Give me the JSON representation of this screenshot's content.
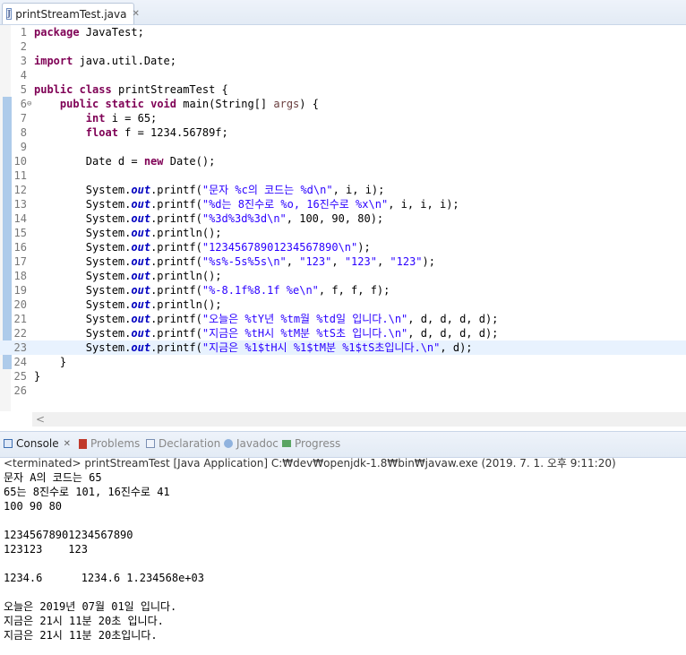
{
  "editor": {
    "tab_label": "printStreamTest.java",
    "tab_close": "✕",
    "file_icon": "J"
  },
  "code_lines": [
    {
      "n": "1",
      "tokens": [
        {
          "t": "package",
          "c": "kw"
        },
        {
          "t": " JavaTest;"
        }
      ]
    },
    {
      "n": "2",
      "tokens": []
    },
    {
      "n": "3",
      "tokens": [
        {
          "t": "import",
          "c": "kw"
        },
        {
          "t": " java.util.Date;"
        }
      ]
    },
    {
      "n": "4",
      "tokens": []
    },
    {
      "n": "5",
      "tokens": [
        {
          "t": "public",
          "c": "kw"
        },
        {
          "t": " "
        },
        {
          "t": "class",
          "c": "kw"
        },
        {
          "t": " printStreamTest {"
        }
      ]
    },
    {
      "n": "6",
      "fold": "⊖",
      "tokens": [
        {
          "t": "    "
        },
        {
          "t": "public",
          "c": "kw"
        },
        {
          "t": " "
        },
        {
          "t": "static",
          "c": "kw"
        },
        {
          "t": " "
        },
        {
          "t": "void",
          "c": "kw"
        },
        {
          "t": " main(String[] "
        },
        {
          "t": "args",
          "c": "var"
        },
        {
          "t": ") {"
        }
      ]
    },
    {
      "n": "7",
      "tokens": [
        {
          "t": "        "
        },
        {
          "t": "int",
          "c": "kw"
        },
        {
          "t": " i = 65;"
        }
      ]
    },
    {
      "n": "8",
      "tokens": [
        {
          "t": "        "
        },
        {
          "t": "float",
          "c": "kw"
        },
        {
          "t": " f = 1234.56789f;"
        }
      ]
    },
    {
      "n": "9",
      "tokens": []
    },
    {
      "n": "10",
      "tokens": [
        {
          "t": "        Date d = "
        },
        {
          "t": "new",
          "c": "kw"
        },
        {
          "t": " Date();"
        }
      ]
    },
    {
      "n": "11",
      "tokens": []
    },
    {
      "n": "12",
      "tokens": [
        {
          "t": "        System."
        },
        {
          "t": "out",
          "c": "fld"
        },
        {
          "t": ".printf("
        },
        {
          "t": "\"문자 %c의 코드는 %d\\n\"",
          "c": "str"
        },
        {
          "t": ", i, i);"
        }
      ]
    },
    {
      "n": "13",
      "tokens": [
        {
          "t": "        System."
        },
        {
          "t": "out",
          "c": "fld"
        },
        {
          "t": ".printf("
        },
        {
          "t": "\"%d는 8진수로 %o, 16진수로 %x\\n\"",
          "c": "str"
        },
        {
          "t": ", i, i, i);"
        }
      ]
    },
    {
      "n": "14",
      "tokens": [
        {
          "t": "        System."
        },
        {
          "t": "out",
          "c": "fld"
        },
        {
          "t": ".printf("
        },
        {
          "t": "\"%3d%3d%3d\\n\"",
          "c": "str"
        },
        {
          "t": ", 100, 90, 80);"
        }
      ]
    },
    {
      "n": "15",
      "tokens": [
        {
          "t": "        System."
        },
        {
          "t": "out",
          "c": "fld"
        },
        {
          "t": ".println();"
        }
      ]
    },
    {
      "n": "16",
      "tokens": [
        {
          "t": "        System."
        },
        {
          "t": "out",
          "c": "fld"
        },
        {
          "t": ".printf("
        },
        {
          "t": "\"12345678901234567890\\n\"",
          "c": "str"
        },
        {
          "t": ");"
        }
      ]
    },
    {
      "n": "17",
      "tokens": [
        {
          "t": "        System."
        },
        {
          "t": "out",
          "c": "fld"
        },
        {
          "t": ".printf("
        },
        {
          "t": "\"%s%-5s%5s\\n\"",
          "c": "str"
        },
        {
          "t": ", "
        },
        {
          "t": "\"123\"",
          "c": "str"
        },
        {
          "t": ", "
        },
        {
          "t": "\"123\"",
          "c": "str"
        },
        {
          "t": ", "
        },
        {
          "t": "\"123\"",
          "c": "str"
        },
        {
          "t": ");"
        }
      ]
    },
    {
      "n": "18",
      "tokens": [
        {
          "t": "        System."
        },
        {
          "t": "out",
          "c": "fld"
        },
        {
          "t": ".println();"
        }
      ]
    },
    {
      "n": "19",
      "tokens": [
        {
          "t": "        System."
        },
        {
          "t": "out",
          "c": "fld"
        },
        {
          "t": ".printf("
        },
        {
          "t": "\"%-8.1f%8.1f %e\\n\"",
          "c": "str"
        },
        {
          "t": ", f, f, f);"
        }
      ]
    },
    {
      "n": "20",
      "tokens": [
        {
          "t": "        System."
        },
        {
          "t": "out",
          "c": "fld"
        },
        {
          "t": ".println();"
        }
      ]
    },
    {
      "n": "21",
      "tokens": [
        {
          "t": "        System."
        },
        {
          "t": "out",
          "c": "fld"
        },
        {
          "t": ".printf("
        },
        {
          "t": "\"오늘은 %tY년 %tm월 %td일 입니다.\\n\"",
          "c": "str"
        },
        {
          "t": ", d, d, d, d);"
        }
      ]
    },
    {
      "n": "22",
      "tokens": [
        {
          "t": "        System."
        },
        {
          "t": "out",
          "c": "fld"
        },
        {
          "t": ".printf("
        },
        {
          "t": "\"지금은 %tH시 %tM분 %tS초 입니다.\\n\"",
          "c": "str"
        },
        {
          "t": ", d, d, d, d);"
        }
      ]
    },
    {
      "n": "23",
      "current": true,
      "tokens": [
        {
          "t": "        System."
        },
        {
          "t": "out",
          "c": "fld"
        },
        {
          "t": ".printf("
        },
        {
          "t": "\"지금은 %1$tH시 %1$tM분 %1$tS초입니다.\\n\"",
          "c": "str"
        },
        {
          "t": ", d);"
        }
      ]
    },
    {
      "n": "24",
      "tokens": [
        {
          "t": "    }"
        }
      ]
    },
    {
      "n": "25",
      "tokens": [
        {
          "t": "}"
        }
      ]
    },
    {
      "n": "26",
      "tokens": []
    }
  ],
  "scroll_left_arrow": "<",
  "console_tabs": [
    {
      "label": "Console",
      "icon": "console-icon",
      "active": true,
      "close": "✕"
    },
    {
      "label": "Problems",
      "icon": "problems-icon"
    },
    {
      "label": "Declaration",
      "icon": "declaration-icon"
    },
    {
      "label": "Javadoc",
      "icon": "javadoc-icon",
      "prefix": "@"
    },
    {
      "label": "Progress",
      "icon": "progress-icon"
    }
  ],
  "console": {
    "terminated": "<terminated> printStreamTest [Java Application] C:₩dev₩openjdk-1.8₩bin₩javaw.exe (2019. 7. 1. 오후 9:11:20)",
    "output": [
      "문자 A의 코드는 65",
      "65는 8진수로 101, 16진수로 41",
      "100 90 80",
      "",
      "12345678901234567890",
      "123123    123",
      "",
      "1234.6      1234.6 1.234568e+03",
      "",
      "오늘은 2019년 07월 01일 입니다.",
      "지금은 21시 11분 20초 입니다.",
      "지금은 21시 11분 20초입니다."
    ]
  },
  "colors": {
    "keyword": "#7f0055",
    "string": "#2a00ff",
    "field": "#0000c0",
    "current_line": "#e8f2fe"
  }
}
